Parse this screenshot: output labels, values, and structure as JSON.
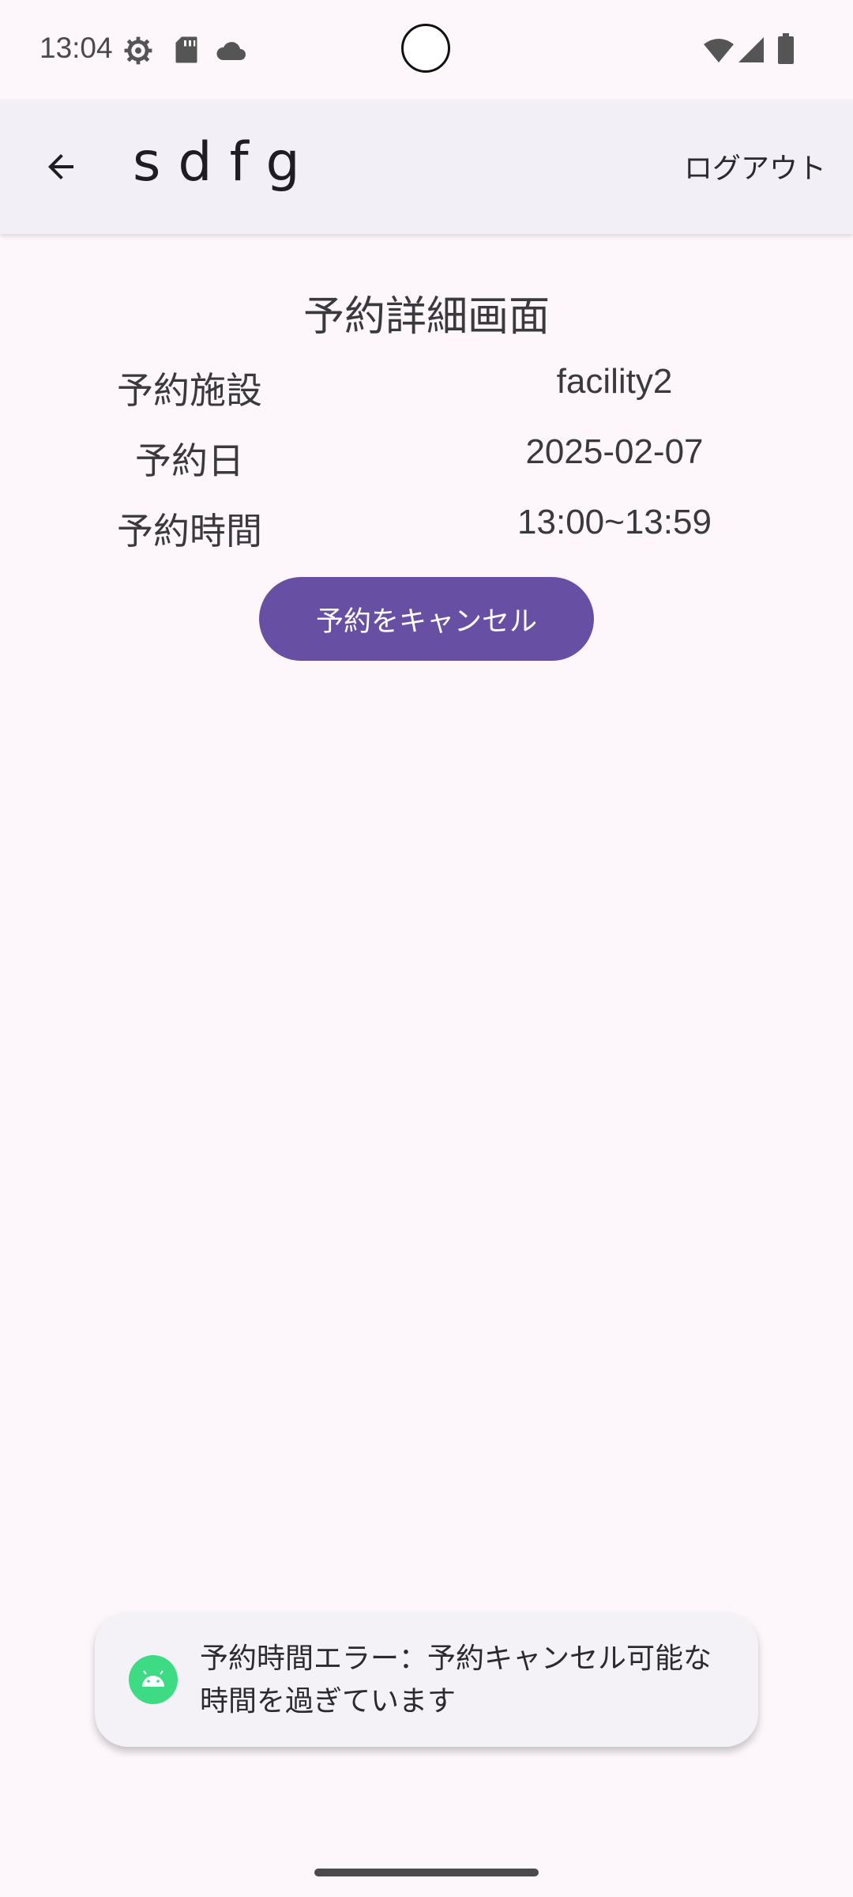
{
  "status_bar": {
    "time": "13:04",
    "icons": [
      "settings-icon",
      "sd-card-icon",
      "cloud-icon",
      "wifi-icon",
      "signal-icon",
      "battery-icon"
    ]
  },
  "app_bar": {
    "title": "sdfg",
    "logout_label": "ログアウト"
  },
  "page": {
    "heading": "予約詳細画面",
    "details": [
      {
        "label": "予約施設",
        "value": "facility2"
      },
      {
        "label": "予約日",
        "value": "2025-02-07"
      },
      {
        "label": "予約時間",
        "value": "13:00~13:59"
      }
    ],
    "cancel_button_label": "予約をキャンセル"
  },
  "toast": {
    "message": "予約時間エラー：予約キャンセル可能な時間を過ぎています"
  },
  "colors": {
    "background": "#fdf7fc",
    "app_bar": "#f2eff6",
    "primary": "#6750a4",
    "android_green": "#3ddc84"
  }
}
